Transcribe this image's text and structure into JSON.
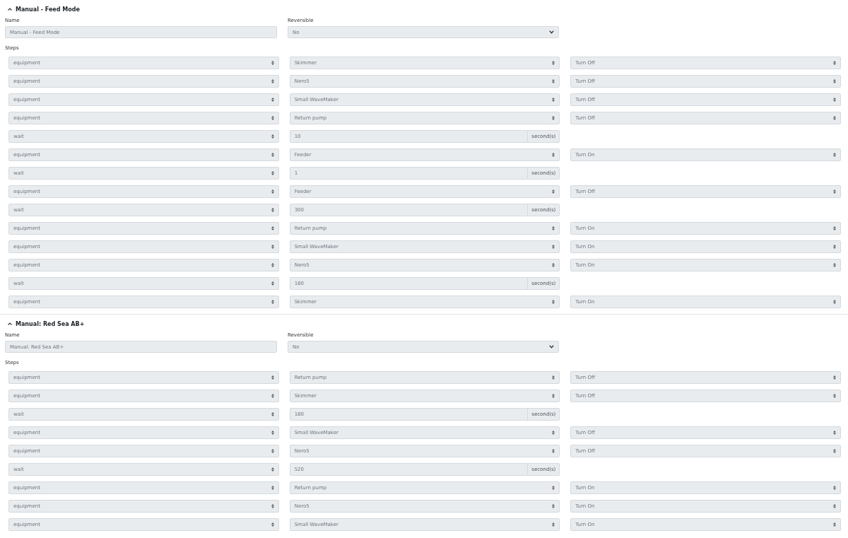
{
  "sections": [
    {
      "title": "Manual - Feed Mode",
      "name_label": "Name",
      "name_value": "Manual - Feed Mode",
      "reversible_label": "Reversible",
      "reversible_value": "No",
      "steps_label": "Steps",
      "steps": [
        {
          "kind": "equipment",
          "type": "equipment",
          "target": "Skimmer",
          "action": "Turn Off"
        },
        {
          "kind": "equipment",
          "type": "equipment",
          "target": "Nero5",
          "action": "Turn Off"
        },
        {
          "kind": "equipment",
          "type": "equipment",
          "target": "Small WaveMaker",
          "action": "Turn Off"
        },
        {
          "kind": "equipment",
          "type": "equipment",
          "target": "Return pump",
          "action": "Turn Off"
        },
        {
          "kind": "wait",
          "type": "wait",
          "value": "10",
          "unit": "second(s)"
        },
        {
          "kind": "equipment",
          "type": "equipment",
          "target": "Feeder",
          "action": "Turn On"
        },
        {
          "kind": "wait",
          "type": "wait",
          "value": "1",
          "unit": "second(s)"
        },
        {
          "kind": "equipment",
          "type": "equipment",
          "target": "Feeder",
          "action": "Turn Off"
        },
        {
          "kind": "wait",
          "type": "wait",
          "value": "300",
          "unit": "second(s)"
        },
        {
          "kind": "equipment",
          "type": "equipment",
          "target": "Return pump",
          "action": "Turn On"
        },
        {
          "kind": "equipment",
          "type": "equipment",
          "target": "Small WaveMaker",
          "action": "Turn On"
        },
        {
          "kind": "equipment",
          "type": "equipment",
          "target": "Nero5",
          "action": "Turn On"
        },
        {
          "kind": "wait",
          "type": "wait",
          "value": "180",
          "unit": "second(s)"
        },
        {
          "kind": "equipment",
          "type": "equipment",
          "target": "Skimmer",
          "action": "Turn On"
        }
      ]
    },
    {
      "title": "Manual: Red Sea AB+",
      "name_label": "Name",
      "name_value": "Manual: Red Sea AB+",
      "reversible_label": "Reversible",
      "reversible_value": "No",
      "steps_label": "Steps",
      "steps": [
        {
          "kind": "equipment",
          "type": "equipment",
          "target": "Return pump",
          "action": "Turn Off"
        },
        {
          "kind": "equipment",
          "type": "equipment",
          "target": "Skimmer",
          "action": "Turn Off"
        },
        {
          "kind": "wait",
          "type": "wait",
          "value": "180",
          "unit": "second(s)"
        },
        {
          "kind": "equipment",
          "type": "equipment",
          "target": "Small WaveMaker",
          "action": "Turn Off"
        },
        {
          "kind": "equipment",
          "type": "equipment",
          "target": "Nero5",
          "action": "Turn Off"
        },
        {
          "kind": "wait",
          "type": "wait",
          "value": "520",
          "unit": "second(s)"
        },
        {
          "kind": "equipment",
          "type": "equipment",
          "target": "Return pump",
          "action": "Turn On"
        },
        {
          "kind": "equipment",
          "type": "equipment",
          "target": "Nero5",
          "action": "Turn On"
        },
        {
          "kind": "equipment",
          "type": "equipment",
          "target": "Small WaveMaker",
          "action": "Turn On"
        }
      ]
    }
  ]
}
